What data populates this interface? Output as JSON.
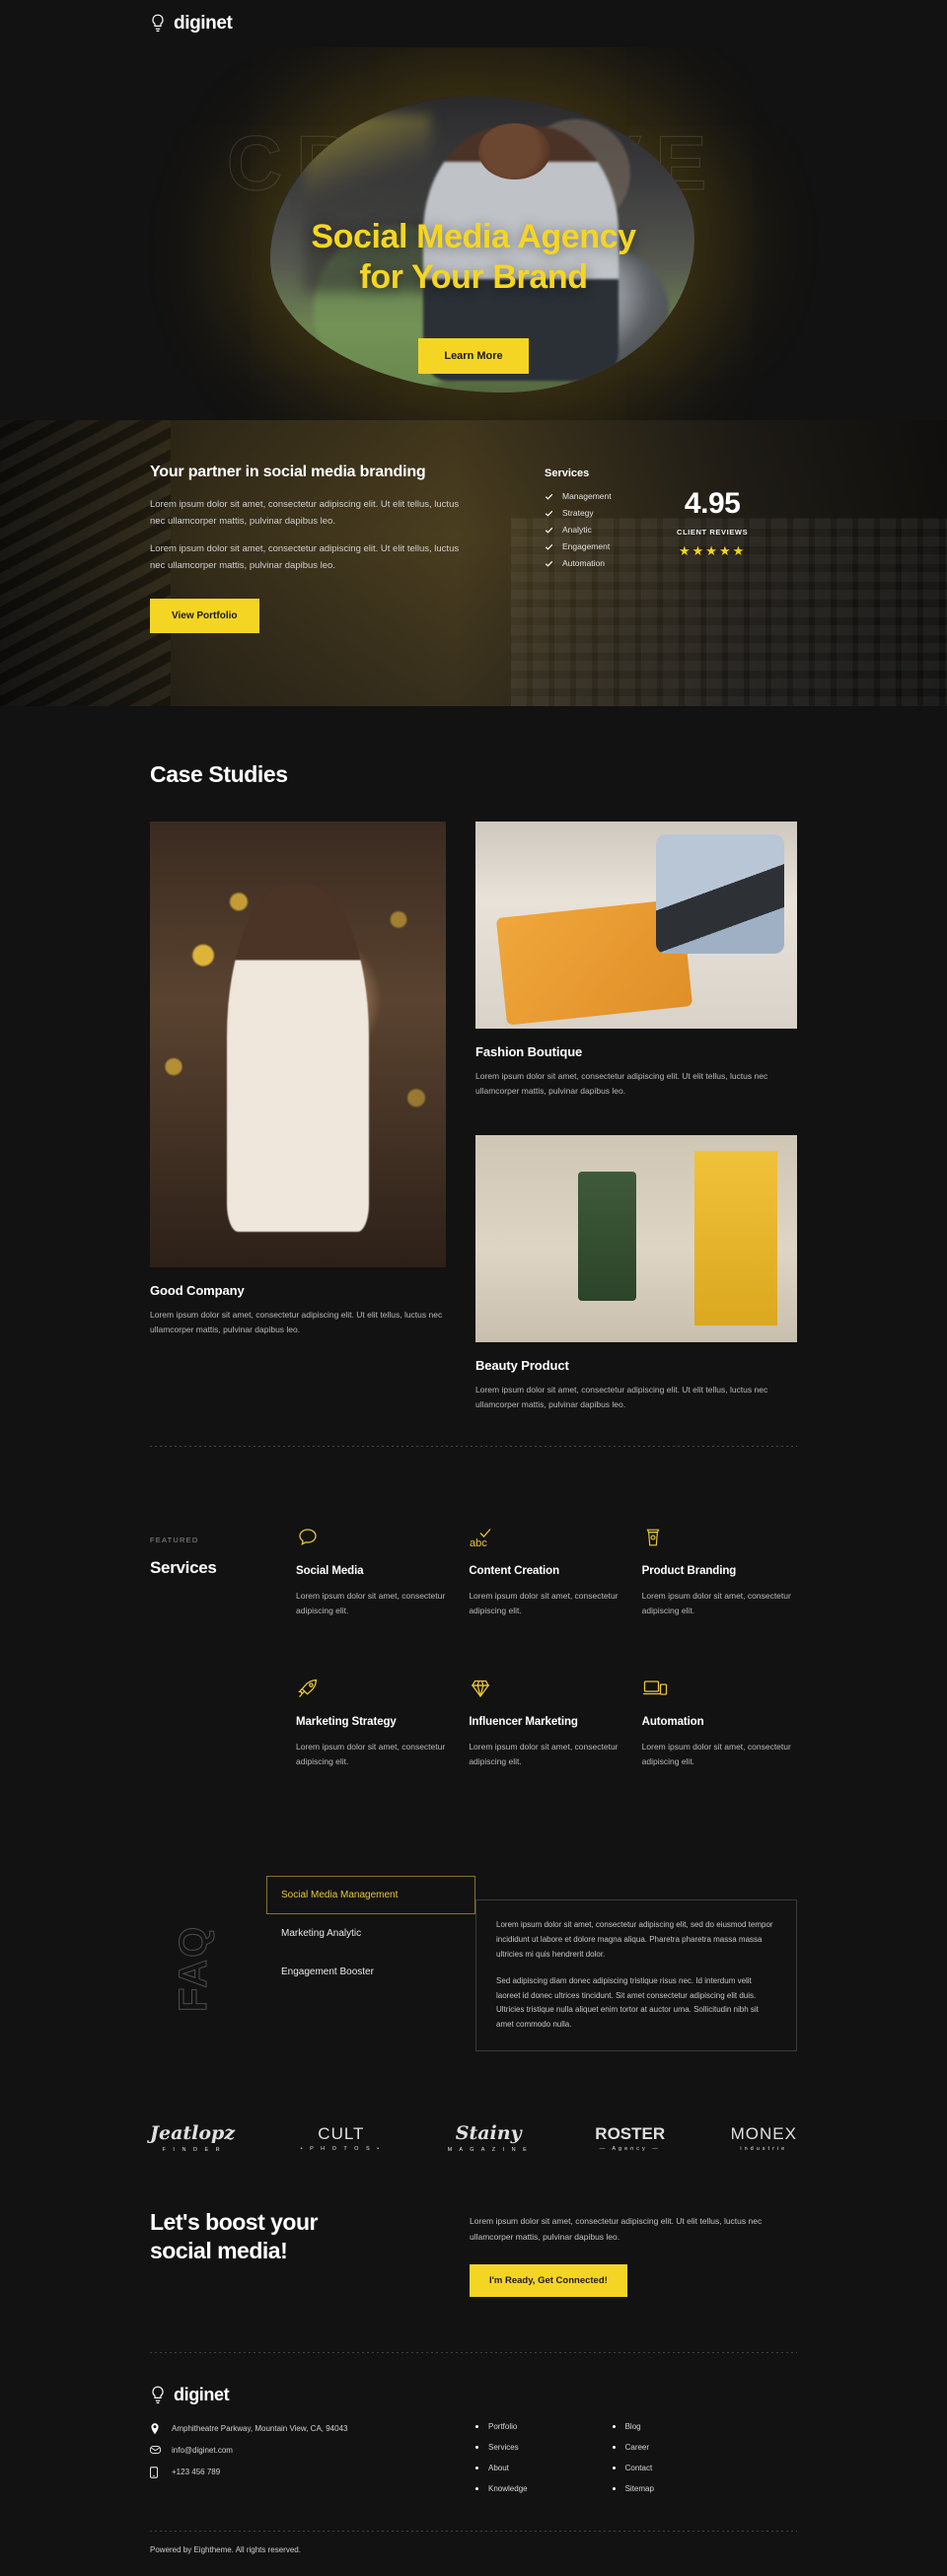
{
  "brand": {
    "name": "diginet",
    "icon": "lightbulb-icon"
  },
  "hero": {
    "background_word": "CREATIVE",
    "headline_line1": "Social Media Agency",
    "headline_line2": "for Your Brand",
    "cta_label": "Learn More",
    "accent": "#f5d524"
  },
  "partner": {
    "title": "Your partner in social media branding",
    "paragraph1": "Lorem ipsum dolor sit amet, consectetur adipiscing elit. Ut elit tellus, luctus nec ullamcorper mattis, pulvinar dapibus leo.",
    "paragraph2": "Lorem ipsum dolor sit amet, consectetur adipiscing elit. Ut elit tellus, luctus nec ullamcorper mattis, pulvinar dapibus leo.",
    "button_label": "View Portfolio",
    "services_title": "Services",
    "services": [
      "Management",
      "Strategy",
      "Analytic",
      "Engagement",
      "Automation"
    ],
    "rating_value": "4.95",
    "rating_label": "CLIENT REVIEWS",
    "stars": "★★★★★"
  },
  "case_studies": {
    "heading": "Case Studies",
    "items": [
      {
        "title": "Good Company",
        "description": "Lorem ipsum dolor sit amet, consectetur adipiscing elit. Ut elit tellus, luctus nec ullamcorper mattis, pulvinar dapibus leo."
      },
      {
        "title": "Fashion Boutique",
        "description": "Lorem ipsum dolor sit amet, consectetur adipiscing elit. Ut elit tellus, luctus nec ullamcorper mattis, pulvinar dapibus leo."
      },
      {
        "title": "Beauty Product",
        "description": "Lorem ipsum dolor sit amet, consectetur adipiscing elit. Ut elit tellus, luctus nec ullamcorper mattis, pulvinar dapibus leo."
      }
    ]
  },
  "services_section": {
    "eyebrow": "FEATURED",
    "heading": "Services",
    "items": [
      {
        "icon": "speech-bubble-icon",
        "name": "Social Media",
        "desc": "Lorem ipsum dolor sit amet, consectetur adipiscing elit."
      },
      {
        "icon": "abc-check-icon",
        "name": "Content Creation",
        "desc": "Lorem ipsum dolor sit amet, consectetur adipiscing elit."
      },
      {
        "icon": "coffee-cup-icon",
        "name": "Product Branding",
        "desc": "Lorem ipsum dolor sit amet, consectetur adipiscing elit."
      },
      {
        "icon": "rocket-icon",
        "name": "Marketing Strategy",
        "desc": "Lorem ipsum dolor sit amet, consectetur adipiscing elit."
      },
      {
        "icon": "diamond-icon",
        "name": "Influencer Marketing",
        "desc": "Lorem ipsum dolor sit amet, consectetur adipiscing elit."
      },
      {
        "icon": "devices-icon",
        "name": "Automation",
        "desc": "Lorem ipsum dolor sit amet, consectetur adipiscing elit."
      }
    ]
  },
  "faq": {
    "side_word": "FAQ",
    "tabs": [
      {
        "label": "Social Media Management",
        "active": true
      },
      {
        "label": "Marketing Analytic",
        "active": false
      },
      {
        "label": "Engagement Booster",
        "active": false
      }
    ],
    "answer_p1": "Lorem ipsum dolor sit amet, consectetur adipiscing elit, sed do eiusmod tempor incididunt ut labore et dolore magna aliqua. Pharetra pharetra massa massa ultricies mi quis hendrerit dolor.",
    "answer_p2": "Sed adipiscing diam donec adipiscing tristique risus nec. Id interdum velit laoreet id donec ultrices tincidunt. Sit amet consectetur adipiscing elit duis. Ultricies tristique nulla aliquet enim tortor at auctor urna. Sollicitudin nibh sit amet commodo nulla."
  },
  "logos": [
    {
      "main": "Jeatlopz",
      "sub": "F I N D E R",
      "style": "script"
    },
    {
      "main": "CULT",
      "sub": "• P H O T O S •",
      "style": "thin"
    },
    {
      "main": "Stainy",
      "sub": "M A G A Z I N E",
      "style": "script"
    },
    {
      "main": "ROSTER",
      "sub": "— Agency —",
      "style": "bold"
    },
    {
      "main": "MONEX",
      "sub": "industrie",
      "style": "thin"
    }
  ],
  "cta": {
    "heading_line1": "Let's boost your",
    "heading_line2": "social media!",
    "paragraph": "Lorem ipsum dolor sit amet, consectetur adipiscing elit. Ut elit tellus, luctus nec ullamcorper mattis, pulvinar dapibus leo.",
    "button_label": "I'm Ready, Get Connected!"
  },
  "footer": {
    "brand": "diginet",
    "address": "Amphitheatre Parkway, Mountain View, CA, 94043",
    "email": "info@diginet.com",
    "phone": "+123 456 789",
    "col1": [
      "Portfolio",
      "Services",
      "About",
      "Knowledge"
    ],
    "col2": [
      "Blog",
      "Career",
      "Contact",
      "Sitemap"
    ],
    "copyright": "Powered by Eightheme. All rights reserved."
  }
}
